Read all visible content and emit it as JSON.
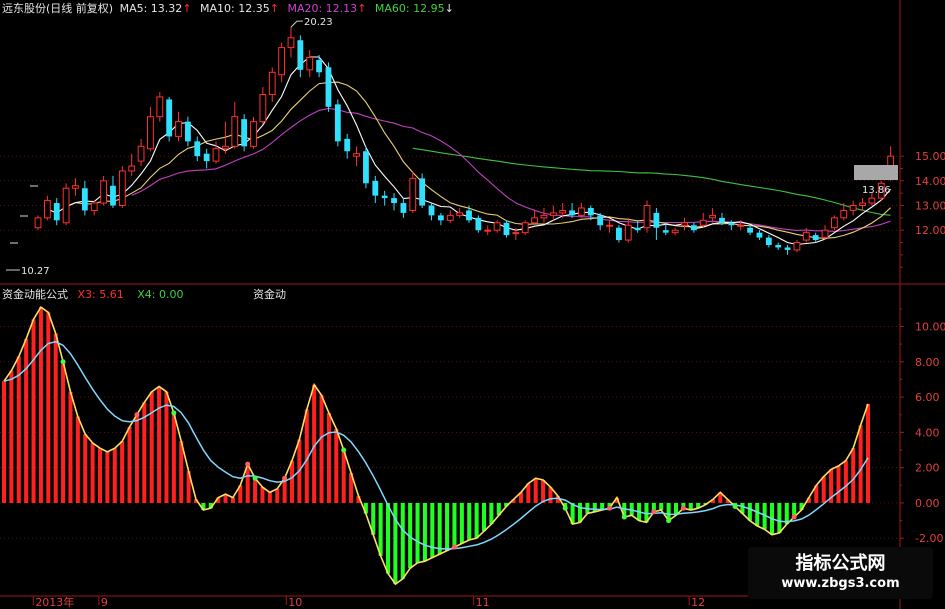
{
  "header": {
    "stock": "远东股份(日线 前复权)",
    "ma5": "MA5: 13.32",
    "ma10": "MA10: 12.35",
    "ma20": "MA20: 12.13",
    "ma60": "MA60: 12.95",
    "up_arrow": "↑",
    "down_arrow": "↓"
  },
  "sub_header": {
    "name": "资金动能公式",
    "x3": "X3: 5.61",
    "x4": "X4: 0.00",
    "tag": "资金动"
  },
  "watermark": {
    "line1": "指标公式网",
    "line2": "www.zbgs3.com"
  },
  "colors": {
    "up": "#ff3030",
    "down": "#30e0ff",
    "ma5": "#ffffff",
    "ma10": "#e8d070",
    "ma20": "#c040c0",
    "ma60": "#40c040",
    "bar_up": "#ff2020",
    "bar_down": "#20ff20",
    "grid": "#8a1a1a",
    "axis_text": "#e04040"
  },
  "chart_data": [
    {
      "type": "candlestick",
      "price_axis": {
        "ticks": [
          12.0,
          13.0,
          14.0,
          15.0
        ],
        "tick_labels": [
          "12.00",
          "13.00",
          "14.00",
          "15.00"
        ],
        "ylim": [
          9.9,
          20.6
        ]
      },
      "annotations": {
        "high": "20.23",
        "low": "10.27",
        "last": "13.86"
      },
      "candles": [
        [
          12.1,
          12.5,
          12.0,
          12.6
        ],
        [
          12.5,
          13.2,
          12.4,
          13.4
        ],
        [
          13.1,
          12.4,
          12.2,
          13.3
        ],
        [
          12.3,
          13.7,
          12.2,
          13.9
        ],
        [
          13.7,
          13.8,
          13.4,
          14.1
        ],
        [
          13.7,
          12.8,
          12.6,
          14.0
        ],
        [
          12.8,
          13.1,
          12.6,
          13.2
        ],
        [
          13.1,
          14.0,
          13.0,
          14.2
        ],
        [
          13.8,
          13.0,
          12.9,
          14.2
        ],
        [
          13.0,
          14.4,
          12.9,
          14.6
        ],
        [
          14.4,
          14.6,
          14.2,
          15.1
        ],
        [
          14.8,
          15.4,
          14.6,
          15.7
        ],
        [
          15.3,
          16.6,
          15.2,
          17.0
        ],
        [
          16.6,
          17.4,
          16.4,
          17.6
        ],
        [
          17.3,
          15.8,
          15.6,
          17.4
        ],
        [
          15.8,
          16.4,
          15.6,
          16.8
        ],
        [
          16.4,
          15.6,
          15.4,
          16.6
        ],
        [
          15.6,
          15.0,
          14.8,
          15.8
        ],
        [
          15.1,
          14.8,
          14.5,
          15.3
        ],
        [
          14.8,
          15.3,
          14.7,
          15.6
        ],
        [
          15.3,
          15.4,
          15.1,
          16.4
        ],
        [
          15.4,
          16.6,
          15.3,
          17.2
        ],
        [
          16.5,
          15.4,
          15.2,
          16.7
        ],
        [
          15.4,
          16.4,
          15.3,
          16.6
        ],
        [
          16.4,
          17.5,
          16.3,
          17.8
        ],
        [
          17.5,
          18.4,
          17.2,
          18.6
        ],
        [
          18.3,
          19.4,
          18.0,
          19.6
        ],
        [
          19.4,
          19.8,
          19.0,
          20.23
        ],
        [
          19.7,
          18.5,
          18.2,
          19.9
        ],
        [
          18.5,
          19.0,
          18.2,
          19.3
        ],
        [
          18.9,
          18.4,
          18.2,
          19.1
        ],
        [
          18.6,
          17.0,
          16.8,
          18.8
        ],
        [
          17.1,
          15.6,
          15.4,
          17.3
        ],
        [
          15.7,
          15.2,
          14.9,
          15.9
        ],
        [
          15.0,
          15.1,
          14.6,
          15.4
        ],
        [
          15.2,
          13.9,
          13.7,
          15.4
        ],
        [
          14.0,
          13.4,
          13.1,
          14.2
        ],
        [
          13.4,
          13.3,
          13.0,
          13.6
        ],
        [
          13.3,
          13.1,
          12.8,
          13.5
        ],
        [
          13.1,
          12.7,
          12.5,
          13.3
        ],
        [
          12.8,
          14.1,
          12.7,
          14.4
        ],
        [
          14.1,
          13.0,
          12.9,
          14.3
        ],
        [
          13.0,
          12.6,
          12.4,
          13.1
        ],
        [
          12.6,
          12.4,
          12.2,
          12.7
        ],
        [
          12.4,
          12.6,
          12.3,
          12.8
        ],
        [
          12.6,
          12.7,
          12.5,
          12.9
        ],
        [
          12.8,
          12.4,
          12.3,
          13.0
        ],
        [
          12.5,
          12.0,
          11.9,
          12.6
        ],
        [
          12.0,
          12.0,
          11.8,
          12.2
        ],
        [
          12.0,
          12.3,
          11.9,
          12.4
        ],
        [
          12.3,
          11.8,
          11.7,
          12.4
        ],
        [
          11.9,
          11.9,
          11.6,
          12.1
        ],
        [
          11.9,
          12.3,
          11.8,
          12.4
        ],
        [
          12.3,
          12.5,
          12.2,
          12.8
        ],
        [
          12.5,
          12.6,
          12.3,
          12.9
        ],
        [
          12.6,
          12.7,
          12.4,
          13.0
        ],
        [
          12.7,
          12.8,
          12.5,
          13.1
        ],
        [
          12.8,
          12.6,
          12.5,
          13.1
        ],
        [
          12.6,
          12.9,
          12.5,
          13.1
        ],
        [
          12.9,
          12.6,
          12.4,
          13.0
        ],
        [
          12.6,
          12.2,
          12.0,
          12.7
        ],
        [
          12.2,
          12.2,
          11.9,
          12.4
        ],
        [
          12.1,
          11.6,
          11.5,
          12.2
        ],
        [
          11.6,
          12.2,
          11.5,
          12.5
        ],
        [
          12.1,
          12.0,
          11.9,
          12.4
        ],
        [
          12.1,
          13.0,
          11.9,
          13.2
        ],
        [
          12.7,
          12.1,
          11.6,
          12.9
        ],
        [
          12.0,
          11.9,
          11.8,
          12.3
        ],
        [
          11.9,
          12.0,
          11.8,
          12.1
        ],
        [
          12.2,
          12.3,
          12.0,
          12.5
        ],
        [
          12.2,
          12.0,
          11.9,
          12.3
        ],
        [
          12.2,
          12.4,
          12.1,
          12.7
        ],
        [
          12.5,
          12.6,
          12.3,
          12.9
        ],
        [
          12.5,
          12.3,
          12.2,
          12.7
        ],
        [
          12.3,
          12.2,
          12.0,
          12.4
        ],
        [
          12.2,
          12.2,
          12.0,
          12.4
        ],
        [
          12.1,
          11.9,
          11.8,
          12.2
        ],
        [
          11.9,
          11.7,
          11.6,
          12.0
        ],
        [
          11.7,
          11.4,
          11.3,
          11.8
        ],
        [
          11.4,
          11.3,
          11.2,
          11.5
        ],
        [
          11.3,
          11.2,
          11.0,
          11.4
        ],
        [
          11.2,
          11.5,
          11.1,
          11.6
        ],
        [
          11.6,
          11.9,
          11.5,
          12.1
        ],
        [
          11.8,
          11.6,
          11.5,
          11.9
        ],
        [
          11.7,
          12.0,
          11.6,
          12.2
        ],
        [
          12.1,
          12.5,
          12.0,
          12.6
        ],
        [
          12.5,
          12.8,
          12.4,
          13.1
        ],
        [
          12.8,
          13.0,
          12.6,
          13.2
        ],
        [
          13.0,
          13.1,
          12.8,
          13.3
        ],
        [
          13.1,
          13.3,
          13.0,
          13.5
        ],
        [
          13.3,
          13.9,
          13.2,
          14.0
        ],
        [
          14.2,
          15.0,
          14.0,
          15.4
        ]
      ]
    },
    {
      "type": "bar",
      "title": "资金动能公式",
      "y_axis": {
        "ticks": [
          -2,
          0,
          2,
          4,
          6,
          8,
          10
        ],
        "tick_labels": [
          "-2.00",
          "0.00",
          "2.00",
          "4.00",
          "6.00",
          "8.00",
          "10.00"
        ],
        "ylim": [
          -5.5,
          11.5
        ]
      },
      "x_labels": [
        {
          "label": "2013年",
          "index": 0
        },
        {
          "label": "9",
          "index": 7
        },
        {
          "label": "10",
          "index": 27
        },
        {
          "label": "11",
          "index": 47
        },
        {
          "label": "12",
          "index": 70
        }
      ],
      "series": [
        {
          "name": "X3",
          "values": [
            6.9,
            7.5,
            8.3,
            9.3,
            10.4,
            11.1,
            10.8,
            9.6,
            8.0,
            6.3,
            4.9,
            3.9,
            3.4,
            3.1,
            2.9,
            3.1,
            3.5,
            4.3,
            5.0,
            5.7,
            6.3,
            6.6,
            6.3,
            5.1,
            3.5,
            1.8,
            0.2,
            -0.4,
            -0.3,
            0.3,
            0.5,
            0.3,
            1.0,
            2.2,
            1.4,
            0.9,
            0.6,
            0.8,
            1.4,
            2.4,
            3.6,
            5.3,
            6.7,
            6.1,
            5.1,
            4.2,
            3.0,
            1.7,
            0.4,
            -0.6,
            -1.8,
            -3.0,
            -4.0,
            -4.6,
            -4.3,
            -3.7,
            -3.4,
            -3.3,
            -3.1,
            -2.9,
            -2.7,
            -2.5,
            -2.3,
            -2.1,
            -2.0,
            -1.6,
            -1.2,
            -0.7,
            -0.2,
            0.2,
            0.6,
            1.1,
            1.4,
            1.3,
            0.9,
            0.4,
            -0.3,
            -1.2,
            -1.1,
            -0.6,
            -0.5,
            -0.4,
            -0.3,
            0.3,
            -0.8,
            -0.7,
            -1.0,
            -1.1,
            -0.5,
            -0.4,
            -1.0,
            -0.7,
            -0.3,
            -0.4,
            -0.3,
            -0.1,
            0.2,
            0.6,
            0.2,
            -0.2,
            -0.6,
            -1.0,
            -1.3,
            -1.5,
            -1.8,
            -1.7,
            -1.2,
            -0.8,
            -0.4,
            0.3,
            1.0,
            1.5,
            1.9,
            2.1,
            2.4,
            3.1,
            4.4,
            5.61
          ]
        },
        {
          "name": "X4",
          "values": []
        }
      ]
    }
  ]
}
